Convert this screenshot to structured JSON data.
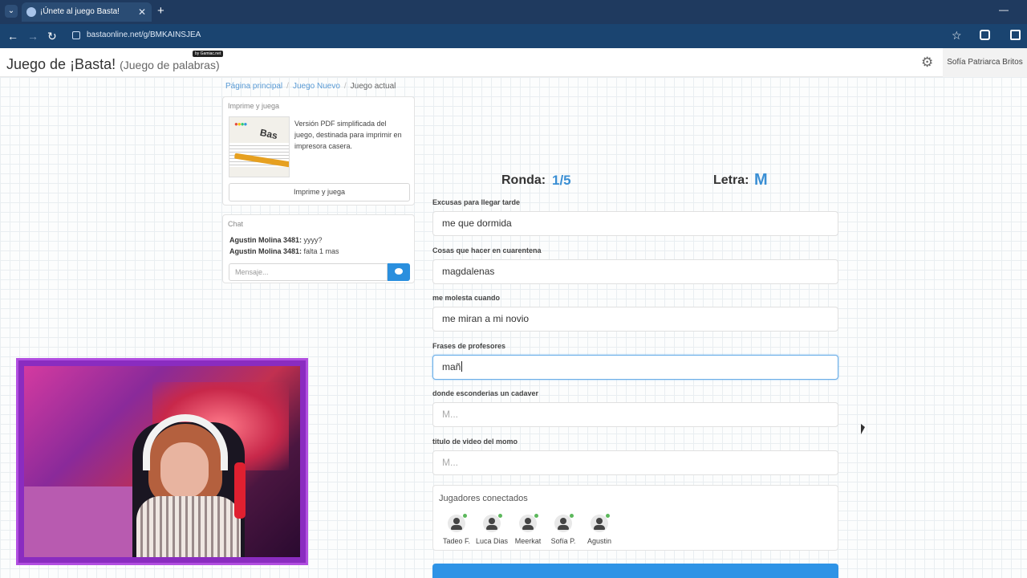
{
  "browser": {
    "tab_title": "¡Únete al juego Basta!",
    "url": "bastaonline.net/g/BMKAINSJEA"
  },
  "header": {
    "title": "Juego de ¡Basta!",
    "subtitle": "(Juego de palabras)",
    "badge": "by Gamiac.net",
    "user": "Sofía Patriarca Britos"
  },
  "breadcrumb": {
    "home": "Página principal",
    "new_game": "Juego Nuevo",
    "current": "Juego actual"
  },
  "print_panel": {
    "title": "Imprime y juega",
    "text": "Versión PDF simplificada del juego, destinada para imprimir en impresora casera.",
    "button": "Imprime y juega"
  },
  "chat": {
    "title": "Chat",
    "messages": [
      {
        "user": "Agustin Molina 3481:",
        "text": "yyyy?"
      },
      {
        "user": "Agustin Molina 3481:",
        "text": "falta 1 mas"
      }
    ],
    "placeholder": "Mensaje..."
  },
  "game": {
    "round_label": "Ronda:",
    "round_value": "1/5",
    "letter_label": "Letra:",
    "letter_value": "M",
    "categories": [
      {
        "label": "Excusas para llegar tarde",
        "value": "me que dormida",
        "placeholder": ""
      },
      {
        "label": "Cosas que hacer en cuarentena",
        "value": "magdalenas",
        "placeholder": ""
      },
      {
        "label": "me molesta cuando",
        "value": "me miran a mi novio",
        "placeholder": ""
      },
      {
        "label": "Frases de profesores",
        "value": "mañ",
        "placeholder": ""
      },
      {
        "label": "donde esconderias un cadaver",
        "value": "",
        "placeholder": "M..."
      },
      {
        "label": "titulo de video del momo",
        "value": "",
        "placeholder": "M..."
      }
    ]
  },
  "players": {
    "title": "Jugadores conectados",
    "list": [
      "Tadeo F.",
      "Luca Dias",
      "Meerkat",
      "Sofía P.",
      "Agustin"
    ]
  },
  "colors": {
    "accent": "#3a8fd4",
    "button": "#2e93e6",
    "online": "#5cb85c",
    "webcam_frame": "#b14ee0"
  }
}
